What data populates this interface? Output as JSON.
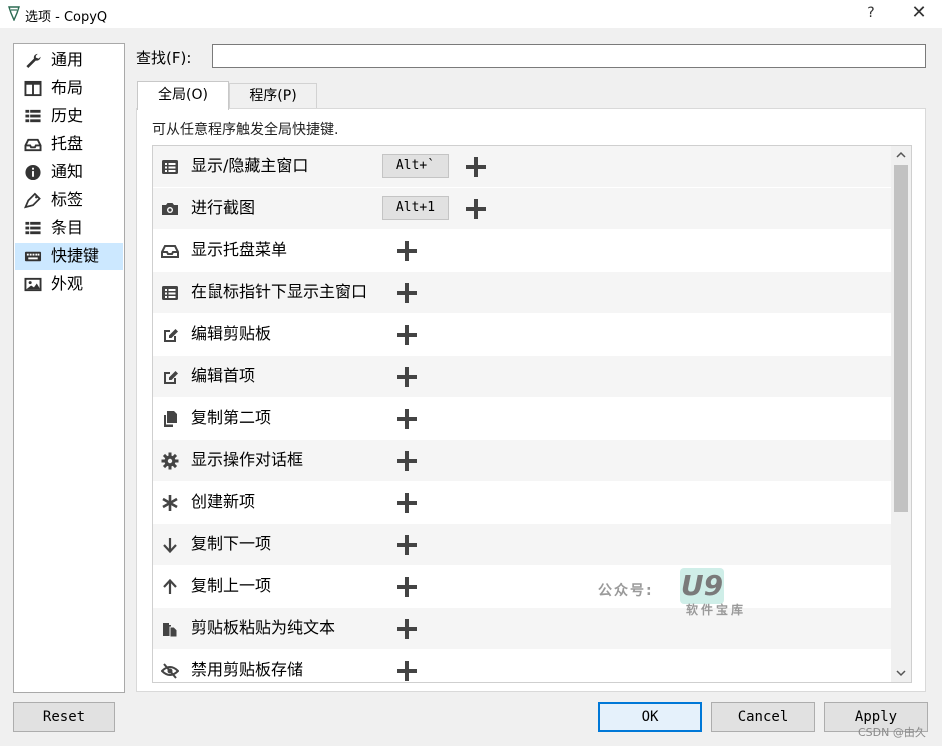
{
  "window": {
    "title": "选项 - CopyQ",
    "help": "?",
    "close": "✕"
  },
  "sidebar": {
    "items": [
      {
        "label": "通用",
        "icon": "wrench-icon"
      },
      {
        "label": "布局",
        "icon": "columns-icon"
      },
      {
        "label": "历史",
        "icon": "list-icon"
      },
      {
        "label": "托盘",
        "icon": "inbox-icon"
      },
      {
        "label": "通知",
        "icon": "info-icon"
      },
      {
        "label": "标签",
        "icon": "tag-icon"
      },
      {
        "label": "条目",
        "icon": "list-icon"
      },
      {
        "label": "快捷键",
        "icon": "keyboard-icon",
        "selected": true
      },
      {
        "label": "外观",
        "icon": "image-icon"
      }
    ]
  },
  "search": {
    "label": "查找(F):",
    "value": ""
  },
  "tabs": [
    {
      "label": "全局(O)",
      "active": true
    },
    {
      "label": "程序(P)",
      "active": false
    }
  ],
  "panel": {
    "description": "可从任意程序触发全局快捷键.",
    "rows": [
      {
        "label": "显示/隐藏主窗口",
        "icon": "list-alt-icon",
        "shortcut": "Alt+`"
      },
      {
        "label": "进行截图",
        "icon": "camera-icon",
        "shortcut": "Alt+1"
      },
      {
        "label": "显示托盘菜单",
        "icon": "inbox-icon",
        "shortcut": ""
      },
      {
        "label": "在鼠标指针下显示主窗口",
        "icon": "list-alt-icon",
        "shortcut": ""
      },
      {
        "label": "编辑剪贴板",
        "icon": "edit-icon",
        "shortcut": ""
      },
      {
        "label": "编辑首项",
        "icon": "edit-icon",
        "shortcut": ""
      },
      {
        "label": "复制第二项",
        "icon": "copy-icon",
        "shortcut": ""
      },
      {
        "label": "显示操作对话框",
        "icon": "cog-icon",
        "shortcut": ""
      },
      {
        "label": "创建新项",
        "icon": "asterisk-icon",
        "shortcut": ""
      },
      {
        "label": "复制下一项",
        "icon": "arrow-down-icon",
        "shortcut": ""
      },
      {
        "label": "复制上一项",
        "icon": "arrow-up-icon",
        "shortcut": ""
      },
      {
        "label": "剪贴板粘贴为纯文本",
        "icon": "paste-icon",
        "shortcut": ""
      },
      {
        "label": "禁用剪贴板存储",
        "icon": "eye-slash-icon",
        "shortcut": ""
      }
    ]
  },
  "watermark": {
    "prefix": "公众号:",
    "logo": "U9",
    "sub": "软件宝库"
  },
  "buttons": {
    "reset": "Reset",
    "ok": "OK",
    "cancel": "Cancel",
    "apply": "Apply"
  },
  "footer_mark": "CSDN @由久",
  "colors": {
    "selection": "#cce8ff",
    "ok_border": "#0078d7",
    "row_alt": "#f5f5f5"
  }
}
